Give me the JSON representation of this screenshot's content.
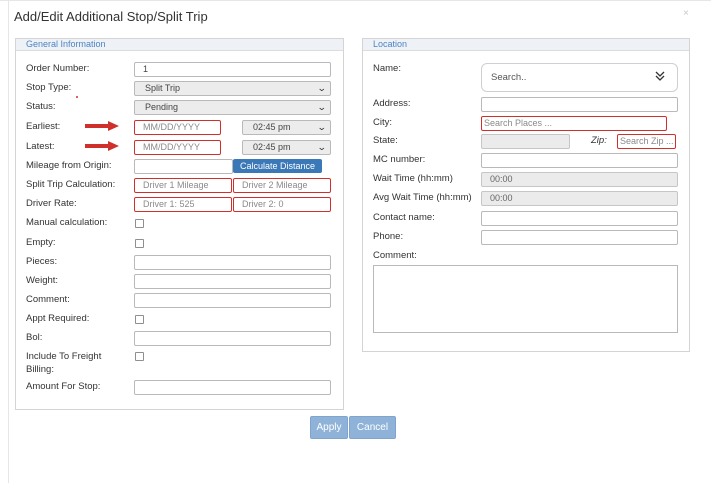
{
  "dialog": {
    "title": "Add/Edit Additional Stop/Split Trip",
    "close": "×"
  },
  "general": {
    "header": "General Information",
    "order_number": {
      "label": "Order Number:",
      "value": "1"
    },
    "stop_type": {
      "label": "Stop Type:",
      "value": "Split Trip"
    },
    "status": {
      "label": "Status:",
      "value": "Pending"
    },
    "earliest": {
      "label": "Earliest:",
      "date_placeholder": "MM/DD/YYYY",
      "time": "02:45 pm"
    },
    "latest": {
      "label": "Latest:",
      "date_placeholder": "MM/DD/YYYY",
      "time": "02:45 pm"
    },
    "mileage": {
      "label": "Mileage from Origin:",
      "button": "Calculate Distance"
    },
    "split_trip": {
      "label": "Split Trip Calculation:",
      "driver1": "Driver 1 Mileage",
      "driver2": "Driver 2 Mileage"
    },
    "driver_rate": {
      "label": "Driver Rate:",
      "driver1": "Driver 1: 525",
      "driver2": "Driver 2: 0"
    },
    "manual_calc": {
      "label": "Manual calculation:"
    },
    "empty": {
      "label": "Empty:"
    },
    "pieces": {
      "label": "Pieces:"
    },
    "weight": {
      "label": "Weight:"
    },
    "comment": {
      "label": "Comment:"
    },
    "appt_required": {
      "label": "Appt Required:"
    },
    "bol": {
      "label": "Bol:"
    },
    "include_freight": {
      "label1": "Include To Freight",
      "label2": "Billing:"
    },
    "amount_for_stop": {
      "label": "Amount For Stop:"
    }
  },
  "location": {
    "header": "Location",
    "name": {
      "label": "Name:",
      "placeholder": "Search.."
    },
    "address": {
      "label": "Address:"
    },
    "city": {
      "label": "City:",
      "placeholder": "Search Places ..."
    },
    "state": {
      "label": "State:"
    },
    "zip": {
      "label": "Zip:",
      "placeholder": "Search Zip ..."
    },
    "mc_number": {
      "label": "MC number:"
    },
    "wait_time": {
      "label": "Wait Time (hh:mm)",
      "value": "00:00"
    },
    "avg_wait_time": {
      "label": "Avg Wait Time (hh:mm)",
      "value": "00:00"
    },
    "contact_name": {
      "label": "Contact name:"
    },
    "phone": {
      "label": "Phone:"
    },
    "comment": {
      "label": "Comment:"
    }
  },
  "actions": {
    "apply": "Apply",
    "cancel": "Cancel"
  },
  "colors": {
    "accent": "#3b78b8",
    "required_border": "#d0302b",
    "arrow": "#d0302b",
    "button_disabled": "#8fb3d8"
  }
}
